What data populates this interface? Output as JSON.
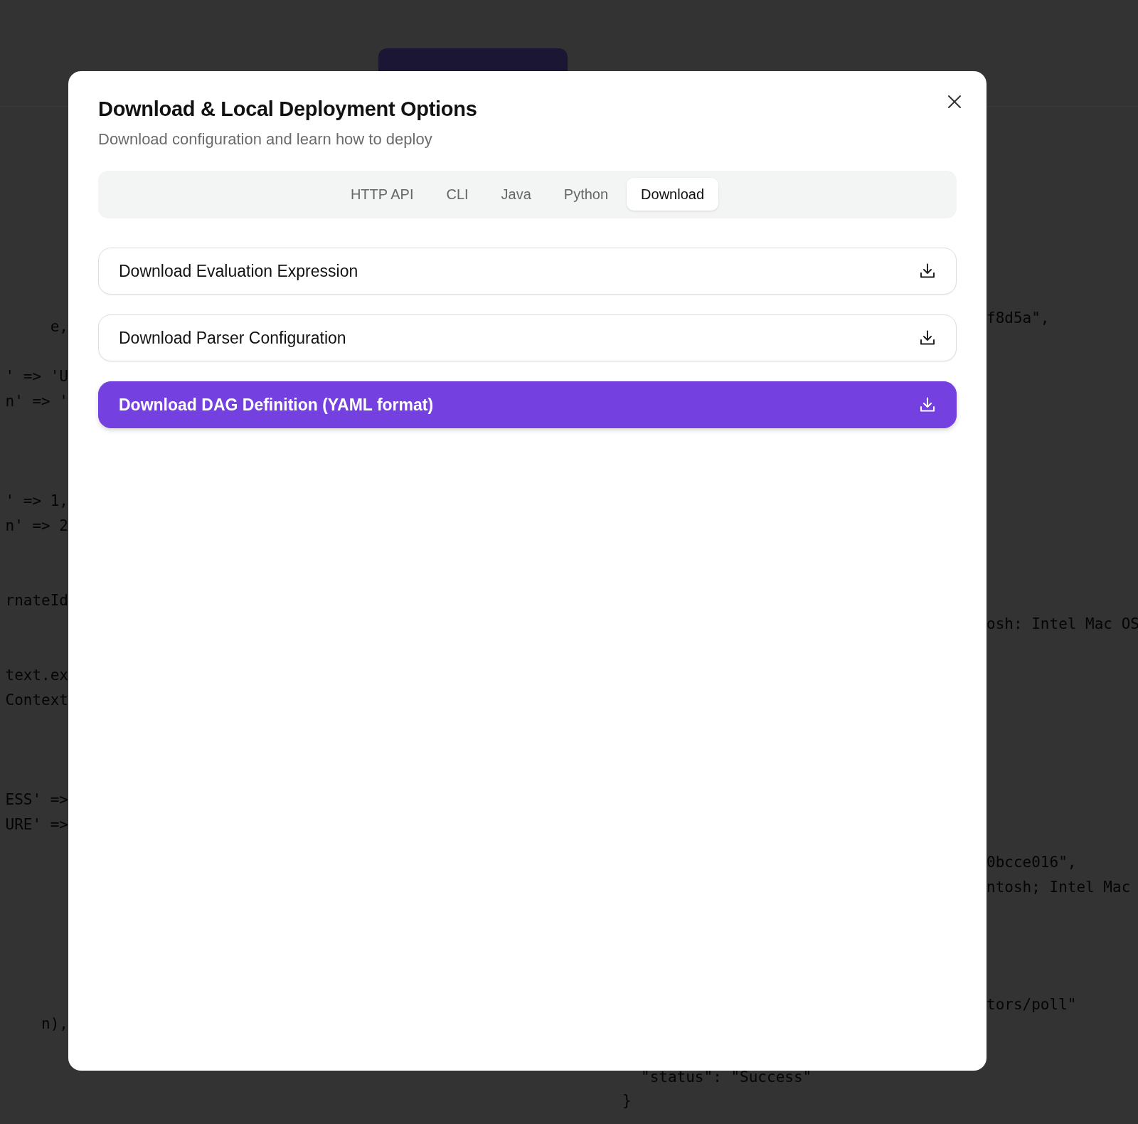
{
  "background": {
    "left_code": [
      [
        "e,"
      ],
      [
        "' => 'U",
        "n' => '"
      ],
      [
        "' => 1,",
        "n' => 2"
      ],
      [
        "rnateId"
      ],
      [
        "text.ex",
        "Context"
      ],
      [
        "ESS' =>",
        "URE' =>"
      ],
      [
        "n),"
      ]
    ],
    "right_code": [
      [
        "f8d5a\","
      ],
      [
        "osh: Intel Mac OS"
      ],
      [
        "0bcce016\",",
        "ntosh; Intel Mac"
      ],
      [
        "tors/poll\""
      ]
    ],
    "bottom_code": [
      "\"status\": \"Success\"",
      "}"
    ]
  },
  "dialog": {
    "title": "Download & Local Deployment Options",
    "subtitle": "Download configuration and learn how to deploy",
    "tabs": [
      {
        "label": "HTTP API",
        "selected": false
      },
      {
        "label": "CLI",
        "selected": false
      },
      {
        "label": "Java",
        "selected": false
      },
      {
        "label": "Python",
        "selected": false
      },
      {
        "label": "Download",
        "selected": true
      }
    ],
    "actions": [
      {
        "label": "Download Evaluation Expression",
        "kind": "outline"
      },
      {
        "label": "Download Parser Configuration",
        "kind": "outline"
      },
      {
        "label": "Download DAG Definition (YAML format)",
        "kind": "primary"
      }
    ]
  }
}
